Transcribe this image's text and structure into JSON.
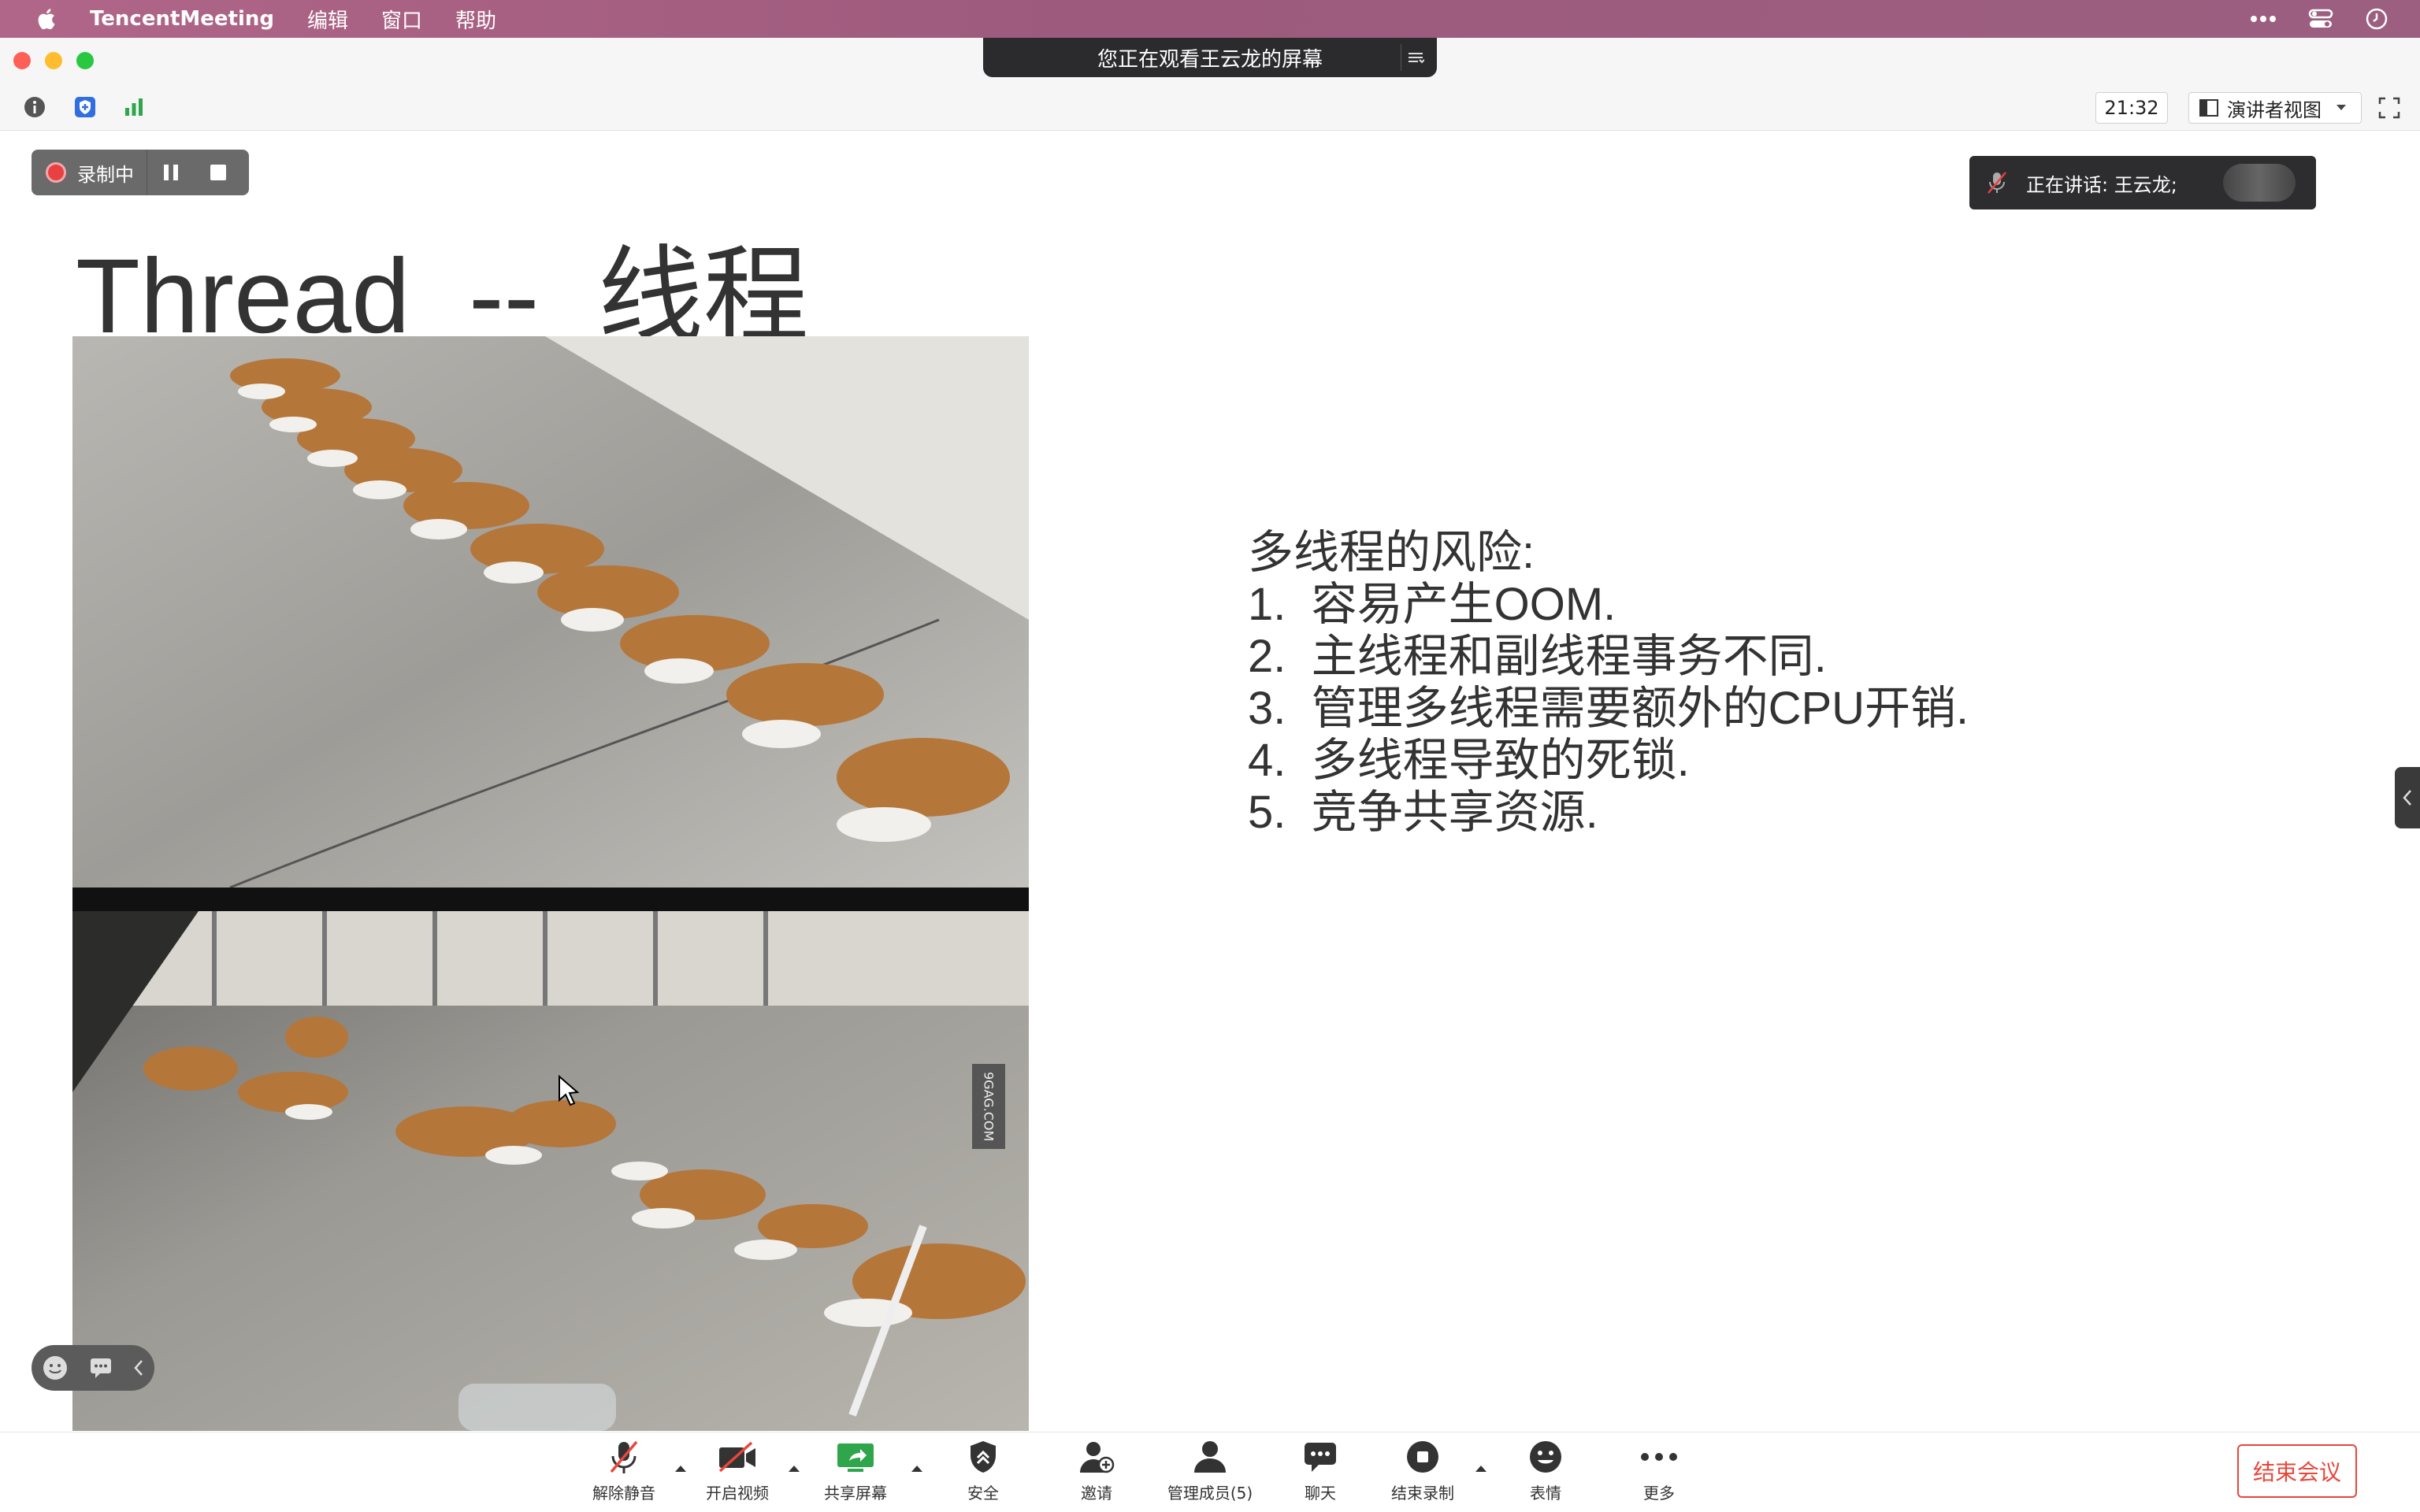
{
  "menubar": {
    "app_name": "TencentMeeting",
    "items": [
      "编辑",
      "窗口",
      "帮助"
    ]
  },
  "window": {
    "viewing_banner": "您正在观看王云龙的屏幕"
  },
  "toolbar": {
    "timer": "21:32",
    "view_mode": "演讲者视图"
  },
  "recording": {
    "label": "录制中"
  },
  "speaking": {
    "label": "正在讲话: 王云龙;"
  },
  "slide": {
    "title": "Thread  --  线程",
    "photo_watermark": "9GAG.COM",
    "risk_heading": "多线程的风险:",
    "risks": [
      "1.  容易产生OOM.",
      "2.  主线程和副线程事务不同.",
      "3.  管理多线程需要额外的CPU开销.",
      "4.  多线程导致的死锁.",
      "5.  竞争共享资源."
    ]
  },
  "controls": {
    "unmute": "解除静音",
    "video": "开启视频",
    "share": "共享屏幕",
    "security": "安全",
    "invite": "邀请",
    "members": "管理成员(5)",
    "chat": "聊天",
    "stop_recording": "结束录制",
    "reactions": "表情",
    "more": "更多",
    "end_meeting": "结束会议"
  },
  "colors": {
    "menubar": "#9d5a7c",
    "end_meeting": "#e8463b",
    "record_dot": "#e84141",
    "share_green": "#2fa64b"
  }
}
